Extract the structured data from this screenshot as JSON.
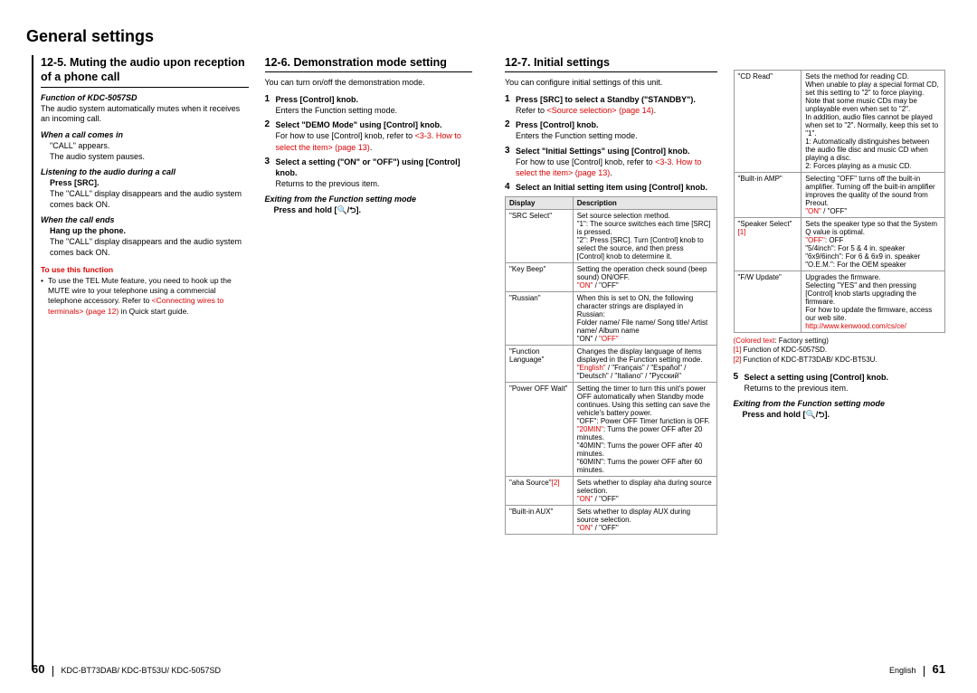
{
  "page_title": "General settings",
  "left_page_num": "60",
  "right_page_num": "61",
  "footer_model": "KDC-BT73DAB/ KDC-BT53U/ KDC-5057SD",
  "footer_lang": "English",
  "sec125": {
    "title": "12-5. Muting the audio upon reception of a phone call",
    "func_of": "Function of KDC-5057SD",
    "intro": "The audio system automatically mutes when  it receives an incoming call.",
    "when_call": "When a call comes in",
    "when_call_line1": "\"CALL\" appears.",
    "when_call_line2": "The audio system pauses.",
    "listening": "Listening to the audio during a call",
    "press_src": "Press [SRC].",
    "listening_body": "The \"CALL\" display disappears and the audio system comes back ON.",
    "when_end": "When the call ends",
    "hang_up": "Hang up the phone.",
    "when_end_body": "The \"CALL\" display disappears and the audio system comes back ON.",
    "note_header": "To use this function",
    "note_bullet": "To use the TEL Mute feature, you need to hook up the MUTE wire to your telephone using a commercial telephone accessory. Refer to ",
    "note_link": "<Connecting wires to terminals> (page 12)",
    "note_bullet_tail": " in Quick start guide."
  },
  "sec126": {
    "title": "12-6. Demonstration mode setting",
    "intro": "You can turn on/off the demonstration mode.",
    "step1_bold": "Press [Control] knob.",
    "step1_body": "Enters the Function setting mode.",
    "step2_bold": "Select \"DEMO Mode\" using [Control] knob.",
    "step2_body_a": "For how to use [Control] knob, refer to ",
    "step2_link": "<3-3. How to select the item> (page 13)",
    "step2_body_b": ".",
    "step3_bold": "Select a setting (\"ON\" or \"OFF\") using [Control] knob.",
    "step3_body": "Returns to the previous item.",
    "exit_head": "Exiting from the Function setting mode",
    "exit_body": "Press and hold [    /    ]."
  },
  "sec127": {
    "title": "12-7. Initial settings",
    "intro": "You can configure initial settings of this unit.",
    "step1_bold": "Press [SRC] to select a Standby (\"STANDBY\").",
    "step1_body_a": "Refer to ",
    "step1_link": "<Source selection> (page 14)",
    "step1_body_b": ".",
    "step2_bold": "Press [Control] knob.",
    "step2_body": "Enters the Function setting mode.",
    "step3_bold": "Select \"Initial Settings\" using [Control] knob.",
    "step3_body_a": "For how to use [Control] knob, refer to ",
    "step3_link": "<3-3. How to select the item> (page 13)",
    "step3_body_b": ".",
    "step4_bold": "Select an Initial setting item using [Control] knob.",
    "table_header_display": "Display",
    "table_header_desc": "Description",
    "rows": [
      {
        "d": "\"SRC Select\"",
        "desc": "Set source selection method.\n\"1\": The source switches each time [SRC] is pressed.\n\"2\": Press [SRC]. Turn [Control] knob to select the source, and then press [Control] knob to determine it."
      },
      {
        "d": "\"Key Beep\"",
        "desc": "Setting the operation check sound (beep sound) ON/OFF.",
        "red": "\"ON\"",
        "tail": " / \"OFF\""
      },
      {
        "d": "\"Russian\"",
        "desc": "When this is set to ON, the following character strings are displayed in Russian:\nFolder name/ File name/ Song title/ Artist name/ Album name",
        "tail": "\"ON\" / ",
        "red2": "\"OFF\""
      },
      {
        "d": "\"Function Language\"",
        "desc": "Changes the display language of items displayed in the Function setting mode.",
        "red": "\"English\"",
        "tail": " / \"Français\" / \"Español\" / \"Deutsch\" / \"Italiano\" / \"Русский\""
      },
      {
        "d": "\"Power OFF Wait\"",
        "desc": "Setting the timer to turn this unit's power OFF automatically when Standby mode continues. Using this setting can save the vehicle's battery power.\n\"OFF\": Power OFF Timer function is OFF.",
        "red": "\"20MIN\"",
        "mid": ": Turns the power OFF after 20 minutes.",
        "extra": "\"40MIN\": Turns the power OFF after 40 minutes.\n\"60MIN\": Turns the power OFF after 60 minutes."
      },
      {
        "d": "\"aha Source\"",
        "dsup": "[2]",
        "desc": "Sets whether to display aha during source selection.",
        "red": "\"ON\"",
        "tail": " / \"OFF\""
      },
      {
        "d": "\"Built-in AUX\"",
        "desc": "Sets whether to display AUX during source selection.",
        "red": "\"ON\"",
        "tail": " / \"OFF\""
      }
    ],
    "rows2": [
      {
        "d": "\"CD Read\"",
        "desc": "Sets the method for reading CD.\nWhen unable to play a special format CD, set this setting to \"2\" to force playing. Note that some music CDs may be unplayable even when set to \"2\".\nIn addition, audio files cannot be played when set to \"2\". Normally, keep this set to \"1\".\n1: Automatically distinguishes between the audio file disc and music CD when playing a disc.\n2: Forces playing as a music CD."
      },
      {
        "d": "\"Built-in AMP\"",
        "desc": "Selecting \"OFF\" turns off the built-in amplifier. Turning off the built-in amplifier improves the quality of the sound from Preout.",
        "red": "\"ON\"",
        "tail": " / \"OFF\""
      },
      {
        "d": "\"Speaker Select\"",
        "dsup": "[1]",
        "desc": "Sets the speaker type so that the System Q value is optimal.",
        "red": "\"OFF\"",
        "mid": ": OFF",
        "extra": "\"5/4inch\": For 5 & 4 in. speaker\n\"6x9/6inch\": For 6 & 6x9 in. speaker\n\"O.E.M.\": For the OEM speaker"
      },
      {
        "d": "\"F/W Update\"",
        "desc": "Upgrades the firmware.\nSelecting \"YES\" and then pressing [Control] knob starts upgrading the firmware.\nFor how to update the firmware, access our web site.",
        "link": "http://www.kenwood.com/cs/ce/"
      }
    ],
    "footnotes": {
      "a": "(Colored text: Factory setting)",
      "b": "[1] Function of KDC-5057SD.",
      "c": "[2] Function of KDC-BT73DAB/ KDC-BT53U."
    },
    "step5_bold": "Select a setting using [Control] knob.",
    "step5_body": "Returns to the previous item.",
    "exit_head": "Exiting from the Function setting mode",
    "exit_body": "Press and hold [    /    ]."
  }
}
